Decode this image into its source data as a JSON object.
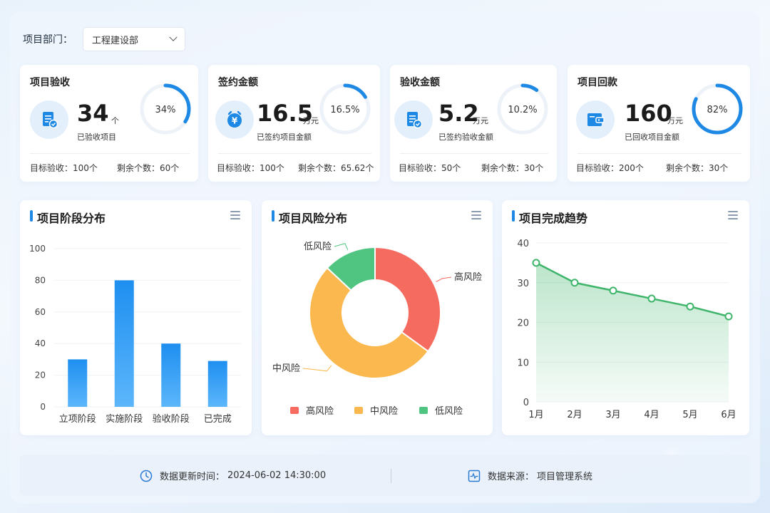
{
  "filter": {
    "label": "项目部门：",
    "selected": "工程建设部"
  },
  "kpis": [
    {
      "title": "项目验收",
      "icon": "document-check-icon",
      "value": "34",
      "unit": "个",
      "sub": "已验收项目",
      "percent_label": "34%",
      "percent": 0.34,
      "foot_left": "目标验收：100个",
      "foot_right": "剩余个数：60个"
    },
    {
      "title": "签约金额",
      "icon": "yen-alarm-icon",
      "value": "16.5",
      "unit": "万元",
      "sub": "已签约项目金额",
      "percent_label": "16.5%",
      "percent": 0.165,
      "foot_left": "目标验收：100个",
      "foot_right": "剩余个数：65.62个"
    },
    {
      "title": "验收金额",
      "icon": "document-check-icon",
      "value": "5.2",
      "unit": "万元",
      "sub": "已签约验收金额",
      "percent_label": "10.2%",
      "percent": 0.102,
      "foot_left": "目标验收：50个",
      "foot_right": "剩余个数：30个"
    },
    {
      "title": "项目回款",
      "icon": "wallet-icon",
      "value": "160",
      "unit": "万元",
      "sub": "已回收项目金额",
      "percent_label": "82%",
      "percent": 0.82,
      "foot_left": "目标验收：200个",
      "foot_right": "剩余个数：30个"
    }
  ],
  "charts": {
    "stage": {
      "title": "项目阶段分布"
    },
    "risk": {
      "title": "项目风险分布"
    },
    "trend": {
      "title": "项目完成趋势"
    }
  },
  "chart_data": [
    {
      "type": "bar",
      "categories": [
        "立项阶段",
        "实施阶段",
        "验收阶段",
        "已完成"
      ],
      "values": [
        30,
        80,
        40,
        29
      ],
      "ylim": [
        0,
        100
      ],
      "yticks": [
        "0",
        "20",
        "40",
        "60",
        "80",
        "100"
      ],
      "color": "#1e8ff0"
    },
    {
      "type": "pie",
      "donut": true,
      "labels": [
        "高风险",
        "中风险",
        "低风险"
      ],
      "values": [
        35,
        52,
        13
      ],
      "colors": [
        "#f56b5f",
        "#fbb84f",
        "#4fc581"
      ],
      "legend": "bottom"
    },
    {
      "type": "area",
      "categories": [
        "1月",
        "2月",
        "3月",
        "4月",
        "5月",
        "6月"
      ],
      "values": [
        35,
        30,
        28,
        26,
        24,
        21.5
      ],
      "ylim": [
        0,
        40
      ],
      "yticks": [
        "0",
        "10",
        "20",
        "30",
        "40"
      ],
      "color": "#3fb56b"
    }
  ],
  "footer": {
    "update_label": "数据更新时间：",
    "update_time": "2024-06-02 14:30:00",
    "source_label": "数据来源：",
    "source_name": "项目管理系统"
  }
}
